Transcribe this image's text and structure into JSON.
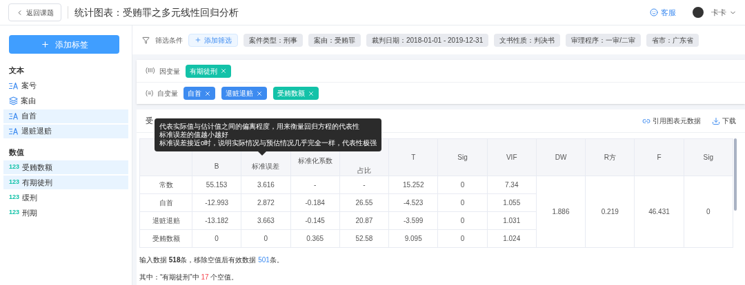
{
  "header": {
    "back_button": "返回课题",
    "title": "统计图表：受贿罪之多元线性回归分析",
    "support": "客服",
    "user": "卡卡"
  },
  "sidebar": {
    "add_button": "添加标签",
    "groups": [
      {
        "title": "文本",
        "items": [
          {
            "label": "案号",
            "kind": "text",
            "selected": false
          },
          {
            "label": "案由",
            "kind": "category",
            "selected": false
          },
          {
            "label": "自首",
            "kind": "text",
            "selected": true
          },
          {
            "label": "退赃退赔",
            "kind": "text",
            "selected": true
          }
        ]
      },
      {
        "title": "数值",
        "items": [
          {
            "label": "受贿数额",
            "kind": "number",
            "badge": "123",
            "selected": true
          },
          {
            "label": "有期徒刑",
            "kind": "number",
            "badge": "123",
            "selected": true
          },
          {
            "label": "缓刑",
            "kind": "number",
            "badge": "123",
            "selected": false
          },
          {
            "label": "刑期",
            "kind": "number",
            "badge": "123",
            "selected": false
          }
        ]
      }
    ]
  },
  "filters": {
    "label": "筛选条件",
    "add_button": "添加筛选",
    "chips": [
      "案件类型：刑事",
      "案由：受贿罪",
      "裁判日期：2018-01-01 - 2019-12-31",
      "文书性质：判决书",
      "审理程序：一审/二审",
      "省市：广东省"
    ]
  },
  "variables": [
    {
      "symbol": "(III)",
      "label": "因变量",
      "tags": [
        {
          "label": "有期徒刑",
          "color": "#13c2a8"
        }
      ]
    },
    {
      "symbol": "(≡)",
      "label": "自变量",
      "tags": [
        {
          "label": "自首",
          "color": "#3d8bf0"
        },
        {
          "label": "退赃退赔",
          "color": "#3d8bf0"
        },
        {
          "label": "受贿数额",
          "color": "#13c2a8"
        }
      ]
    }
  ],
  "results": {
    "title": "受",
    "actions": [
      {
        "label": "引用图表元数据",
        "kind": "link"
      },
      {
        "label": "下载",
        "kind": "download"
      }
    ],
    "table": {
      "columns": [
        "B",
        "标准误差",
        "标准化系数",
        "占比",
        "T",
        "Sig",
        "VIF",
        "DW",
        "R方",
        "F",
        "Sig"
      ],
      "rows": [
        {
          "label": "常数",
          "cells": [
            "55.153",
            "3.616",
            "-",
            "-",
            "15.252",
            "0",
            "7.34"
          ]
        },
        {
          "label": "自首",
          "cells": [
            "-12.993",
            "2.872",
            "-0.184",
            "26.55",
            "-4.523",
            "0",
            "1.055"
          ]
        },
        {
          "label": "退赃退赔",
          "cells": [
            "-13.182",
            "3.663",
            "-0.145",
            "20.87",
            "-3.599",
            "0",
            "1.031"
          ]
        },
        {
          "label": "受贿数额",
          "cells": [
            "0",
            "0",
            "0.365",
            "52.58",
            "9.095",
            "0",
            "1.024"
          ]
        }
      ],
      "summary": [
        "1.886",
        "0.219",
        "46.431",
        "0"
      ]
    },
    "notes": [
      [
        {
          "text": "输入数据 ",
          "kind": "text"
        },
        {
          "text": "518",
          "kind": "total"
        },
        {
          "text": "条，移除空值后有效数据 ",
          "kind": "text"
        },
        {
          "text": "501",
          "kind": "valid"
        },
        {
          "text": "条。",
          "kind": "text"
        }
      ],
      [
        {
          "text": "其中：“有期徒刑”中 ",
          "kind": "text"
        },
        {
          "text": "17",
          "kind": "missing"
        },
        {
          "text": " 个空值。",
          "kind": "text"
        }
      ]
    ],
    "tooltip": [
      "代表实际值与估计值之间的偏离程度，用来衡量回归方程的代表性",
      "标准误差的值越小越好",
      "标准误差接近0时，说明实际情况与预估情况几乎完全一样，代表性极强"
    ]
  }
}
